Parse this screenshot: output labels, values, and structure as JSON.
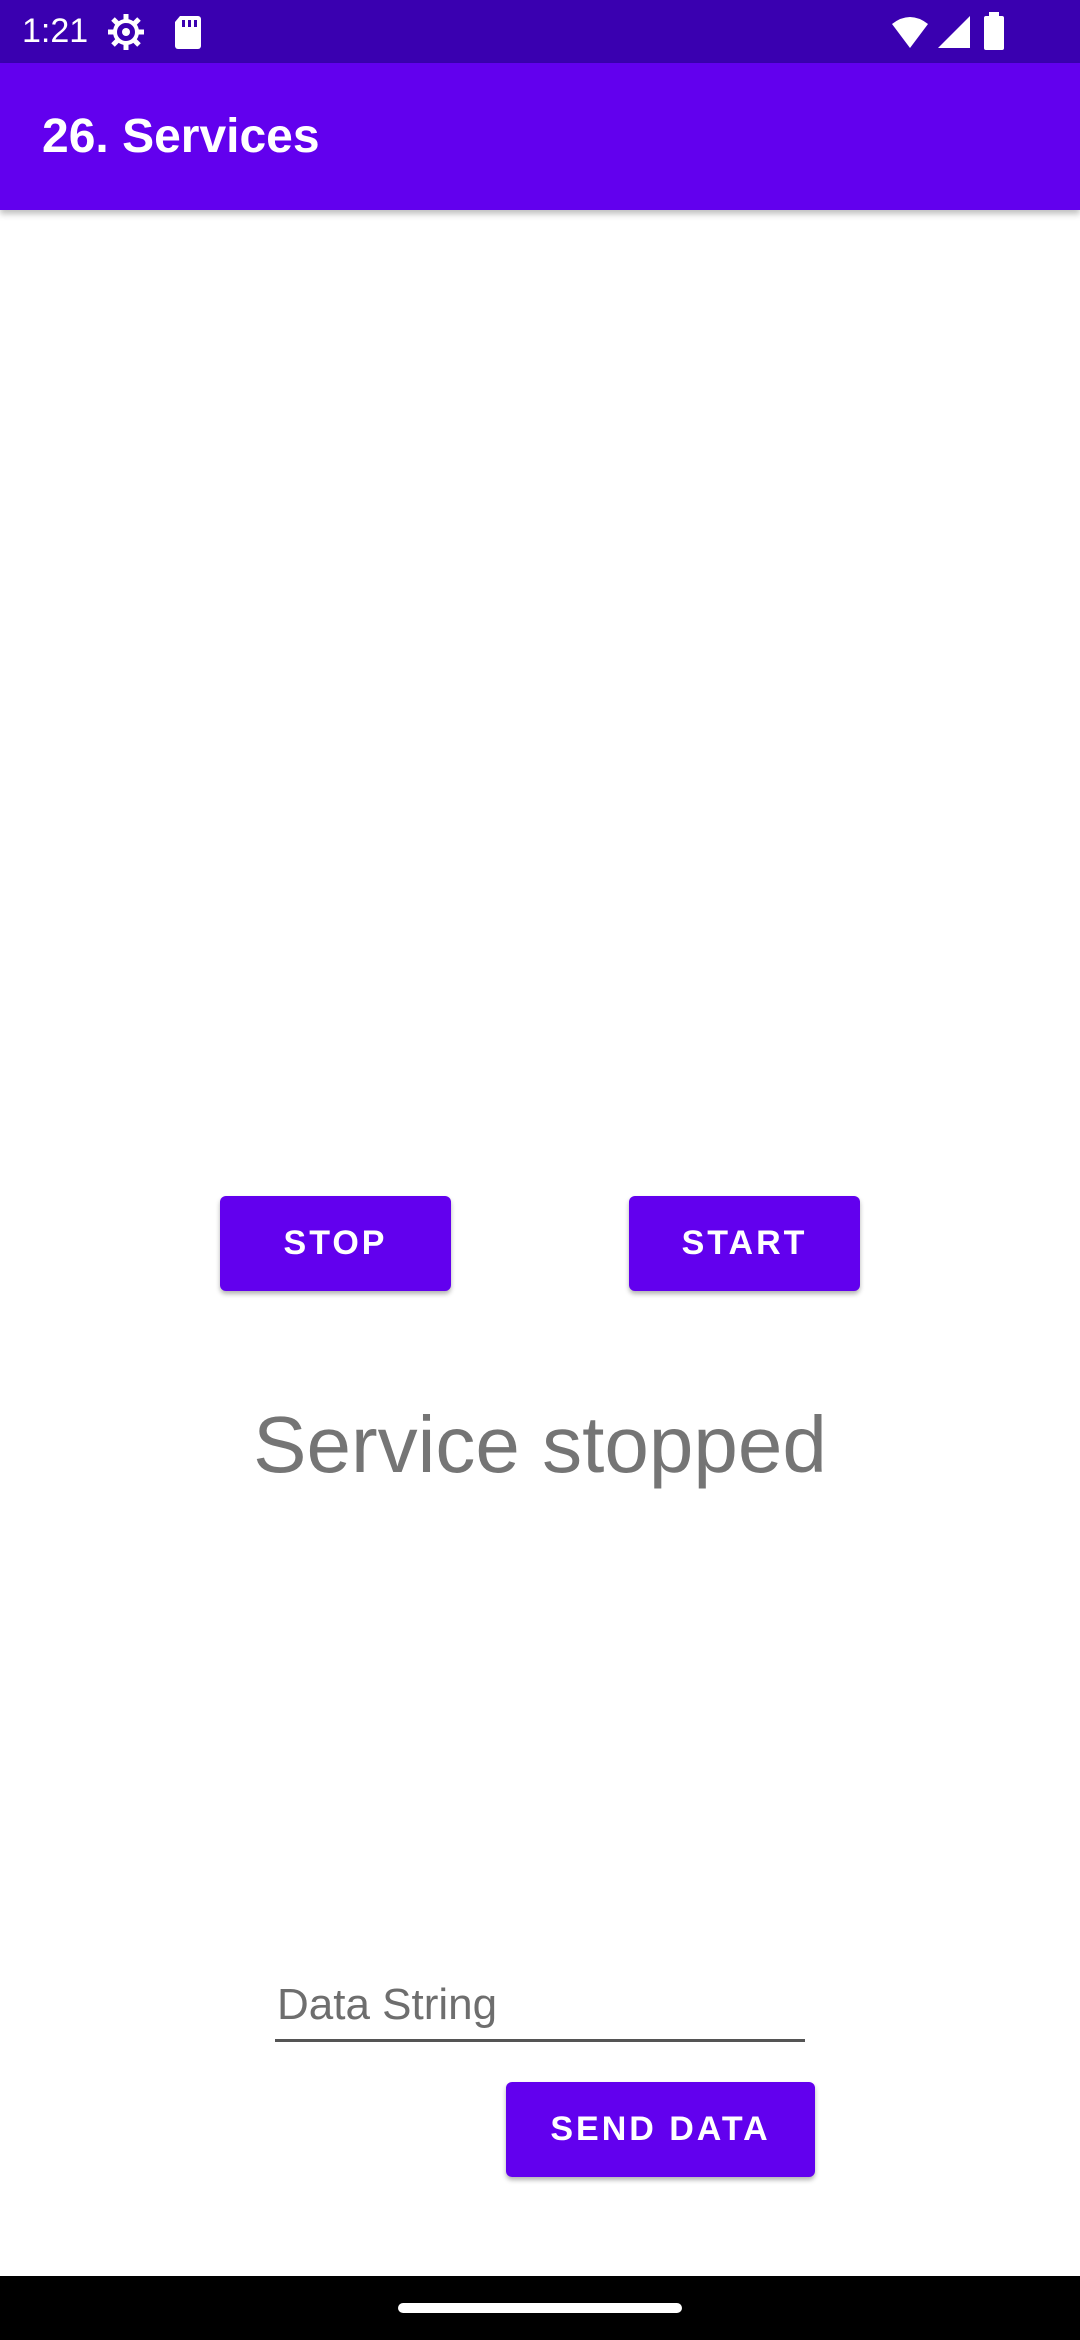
{
  "status_bar": {
    "time": "1:21",
    "icons": [
      "settings-icon",
      "sd-card-icon",
      "wifi-icon",
      "signal-icon",
      "battery-icon"
    ]
  },
  "app_bar": {
    "title": "26. Services",
    "color": "#6200ee"
  },
  "controls": {
    "stop_label": "STOP",
    "start_label": "START",
    "service_status": "Service stopped",
    "data_placeholder": "Data String",
    "data_value": "",
    "send_label": "SEND DATA"
  },
  "colors": {
    "primary": "#6200ee",
    "primary_dark": "#3a00b0"
  }
}
